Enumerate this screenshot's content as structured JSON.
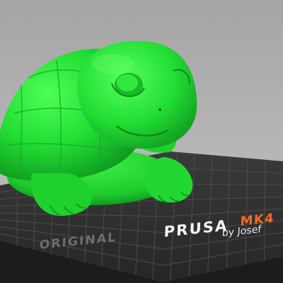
{
  "bed": {
    "brand_original": "ORIGINAL",
    "brand_prusa": "PRUSA",
    "brand_model": "MK4",
    "brand_byline": "by Josef"
  },
  "colors": {
    "background_top": "#a5a5a5",
    "background_bottom": "#c4c4c4",
    "bed_surface": "#2e2e2e",
    "bed_grid": "#4a4a4a",
    "bed_edge": "#1a1a1a",
    "model": "#22dd33",
    "model_shadow": "#0f8a1a",
    "accent_orange": "#f36b21"
  },
  "model": {
    "icon": "turtle-model"
  }
}
